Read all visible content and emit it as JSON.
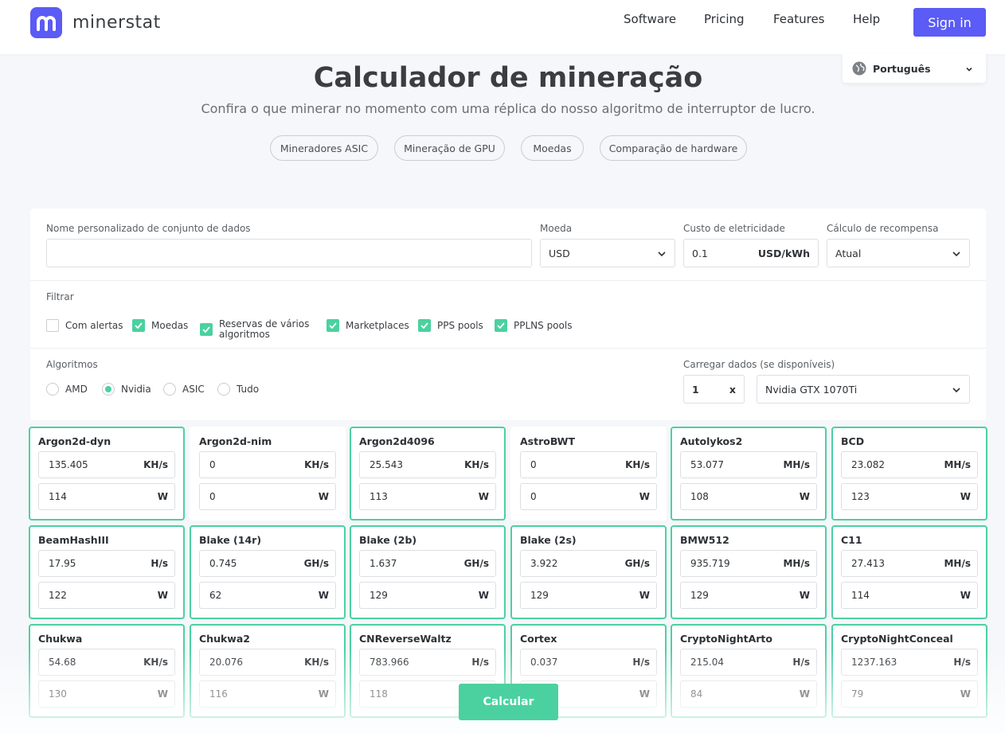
{
  "header": {
    "brand": "minerstat",
    "nav": [
      "Software",
      "Pricing",
      "Features",
      "Help"
    ],
    "signin": "Sign in",
    "language": "Português"
  },
  "hero": {
    "title": "Calculador de mineração",
    "subtitle": "Confira o que minerar no momento com uma réplica do nosso algoritmo de interruptor de lucro.",
    "pills": [
      "Mineradores ASIC",
      "Mineração de GPU",
      "Moedas",
      "Comparação de hardware"
    ]
  },
  "form": {
    "dataset_label": "Nome personalizado de conjunto de dados",
    "dataset_value": "",
    "currency_label": "Moeda",
    "currency_value": "USD",
    "electricity_label": "Custo de eletricidade",
    "electricity_value": "0.1",
    "electricity_unit": "USD/kWh",
    "reward_label": "Cálculo de recompensa",
    "reward_value": "Atual",
    "filter_label": "Filtrar",
    "filters": [
      {
        "label": "Com alertas",
        "checked": false
      },
      {
        "label": "Moedas",
        "checked": true
      },
      {
        "label": "Reservas de vários\nalgoritmos",
        "checked": true
      },
      {
        "label": "Marketplaces",
        "checked": true
      },
      {
        "label": "PPS pools",
        "checked": true
      },
      {
        "label": "PPLNS pools",
        "checked": true
      }
    ],
    "algorithms_label": "Algoritmos",
    "algorithm_options": [
      {
        "label": "AMD",
        "selected": false
      },
      {
        "label": "Nvidia",
        "selected": true
      },
      {
        "label": "ASIC",
        "selected": false
      },
      {
        "label": "Tudo",
        "selected": false
      }
    ],
    "load_label": "Carregar dados (se disponíveis)",
    "quantity": "1",
    "quantity_clear": "x",
    "hardware": "Nvidia GTX 1070Ti"
  },
  "algorithms": [
    {
      "name": "Argon2d-dyn",
      "hashrate": "135.405",
      "unit": "KH/s",
      "power": "114",
      "power_unit": "W",
      "active": true
    },
    {
      "name": "Argon2d-nim",
      "hashrate": "0",
      "unit": "KH/s",
      "power": "0",
      "power_unit": "W",
      "active": false
    },
    {
      "name": "Argon2d4096",
      "hashrate": "25.543",
      "unit": "KH/s",
      "power": "113",
      "power_unit": "W",
      "active": true
    },
    {
      "name": "AstroBWT",
      "hashrate": "0",
      "unit": "KH/s",
      "power": "0",
      "power_unit": "W",
      "active": false
    },
    {
      "name": "Autolykos2",
      "hashrate": "53.077",
      "unit": "MH/s",
      "power": "108",
      "power_unit": "W",
      "active": true
    },
    {
      "name": "BCD",
      "hashrate": "23.082",
      "unit": "MH/s",
      "power": "123",
      "power_unit": "W",
      "active": true
    },
    {
      "name": "BeamHashIII",
      "hashrate": "17.95",
      "unit": "H/s",
      "power": "122",
      "power_unit": "W",
      "active": true
    },
    {
      "name": "Blake (14r)",
      "hashrate": "0.745",
      "unit": "GH/s",
      "power": "62",
      "power_unit": "W",
      "active": true
    },
    {
      "name": "Blake (2b)",
      "hashrate": "1.637",
      "unit": "GH/s",
      "power": "129",
      "power_unit": "W",
      "active": true
    },
    {
      "name": "Blake (2s)",
      "hashrate": "3.922",
      "unit": "GH/s",
      "power": "129",
      "power_unit": "W",
      "active": true
    },
    {
      "name": "BMW512",
      "hashrate": "935.719",
      "unit": "MH/s",
      "power": "129",
      "power_unit": "W",
      "active": true
    },
    {
      "name": "C11",
      "hashrate": "27.413",
      "unit": "MH/s",
      "power": "114",
      "power_unit": "W",
      "active": true
    },
    {
      "name": "Chukwa",
      "hashrate": "54.68",
      "unit": "KH/s",
      "power": "130",
      "power_unit": "W",
      "active": true
    },
    {
      "name": "Chukwa2",
      "hashrate": "20.076",
      "unit": "KH/s",
      "power": "116",
      "power_unit": "W",
      "active": true
    },
    {
      "name": "CNReverseWaltz",
      "hashrate": "783.966",
      "unit": "H/s",
      "power": "118",
      "power_unit": "W",
      "active": true
    },
    {
      "name": "Cortex",
      "hashrate": "0.037",
      "unit": "H/s",
      "power": "",
      "power_unit": "W",
      "active": true
    },
    {
      "name": "CryptoNightArto",
      "hashrate": "215.04",
      "unit": "H/s",
      "power": "84",
      "power_unit": "W",
      "active": true
    },
    {
      "name": "CryptoNightConceal",
      "hashrate": "1237.163",
      "unit": "H/s",
      "power": "79",
      "power_unit": "W",
      "active": true
    }
  ],
  "calculate": "Calcular",
  "colors": {
    "brand": "#5b5bf5",
    "accent": "#4bd1a0"
  },
  "icons": {
    "chevron": "chevron-down-icon",
    "globe": "globe-icon",
    "check": "check-icon"
  }
}
